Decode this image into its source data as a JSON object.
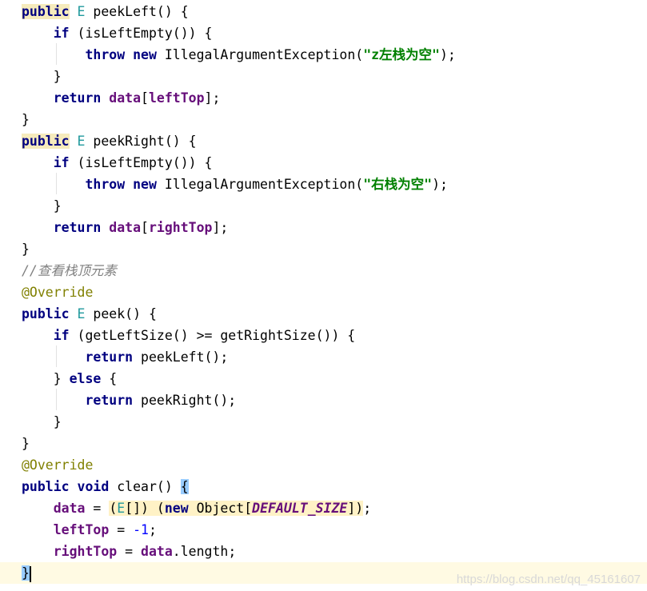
{
  "code": {
    "l1": {
      "kw": "public",
      "type": "E",
      "rest": " peekLeft() {"
    },
    "l2": {
      "kw": "if",
      "rest": " (isLeftEmpty()) {"
    },
    "l3": {
      "kw1": "throw",
      "kw2": "new",
      "cls": " IllegalArgumentException(",
      "str": "\"z左栈为空\"",
      "end": ");"
    },
    "l4": {
      "text": "}"
    },
    "l5": {
      "kw": "return",
      "field": "data",
      "open": "[",
      "field2": "leftTop",
      "close": "];"
    },
    "l6": {
      "text": "}"
    },
    "l7": {
      "kw": "public",
      "type": "E",
      "rest": " peekRight() {"
    },
    "l8": {
      "kw": "if",
      "rest": " (isLeftEmpty()) {"
    },
    "l9": {
      "kw1": "throw",
      "kw2": "new",
      "cls": " IllegalArgumentException(",
      "str": "\"右栈为空\"",
      "end": ");"
    },
    "l10": {
      "text": "}"
    },
    "l11": {
      "kw": "return",
      "field": "data",
      "open": "[",
      "field2": "rightTop",
      "close": "];"
    },
    "l12": {
      "text": "}"
    },
    "l13": {
      "comment": "//查看栈顶元素"
    },
    "l14": {
      "annotation": "@Override"
    },
    "l15": {
      "kw": "public",
      "type": "E",
      "rest": " peek() {"
    },
    "l16": {
      "kw": "if",
      "rest": " (getLeftSize() >= getRightSize()) {"
    },
    "l17": {
      "kw": "return",
      "rest": " peekLeft();"
    },
    "l18": {
      "pre": "} ",
      "kw": "else",
      "rest": " {"
    },
    "l19": {
      "kw": "return",
      "rest": " peekRight();"
    },
    "l20": {
      "text": "}"
    },
    "l21": {
      "text": "}"
    },
    "l22": {
      "annotation": "@Override"
    },
    "l23": {
      "kw1": "public",
      "kw2": "void",
      "rest": " clear() ",
      "brace": "{"
    },
    "l24": {
      "field": "data",
      "eq": " = ",
      "paren": "(",
      "type": "E",
      "arr": "[]) (",
      "kw": "new",
      "obj": " Object[",
      "const": "DEFAULT_SIZE",
      "close": "])",
      "semi": ";"
    },
    "l25": {
      "field": "leftTop",
      "eq": " = ",
      "num": "-1",
      "semi": ";"
    },
    "l26": {
      "field": "rightTop",
      "eq": " = ",
      "field2": "data",
      "rest": ".length;"
    },
    "l27": {
      "text": "}"
    }
  },
  "watermark": "https://blog.csdn.net/qq_45161607"
}
